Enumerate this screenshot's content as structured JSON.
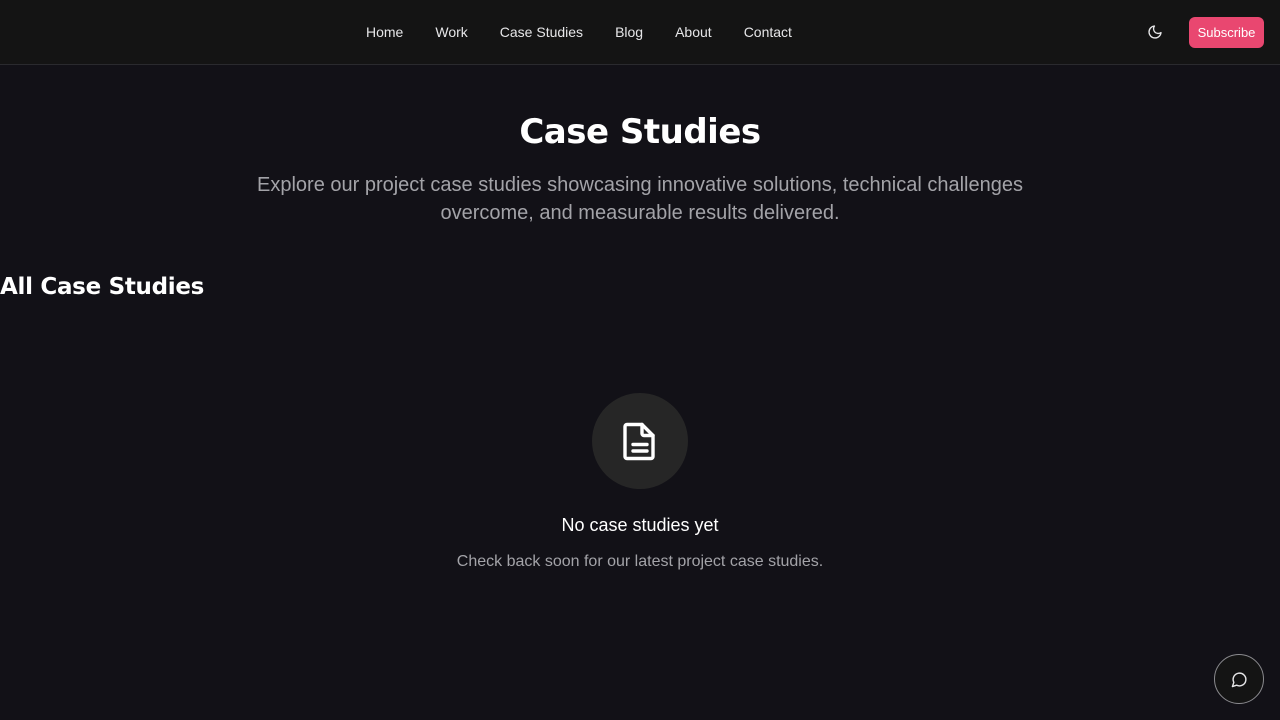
{
  "nav": {
    "items": [
      {
        "label": "Home"
      },
      {
        "label": "Work"
      },
      {
        "label": "Case Studies"
      },
      {
        "label": "Blog"
      },
      {
        "label": "About"
      },
      {
        "label": "Contact"
      }
    ],
    "theme_toggle_icon": "moon-icon",
    "subscribe_label": "Subscribe"
  },
  "hero": {
    "title": "Case Studies",
    "subtitle": "Explore our project case studies showcasing innovative solutions, technical challenges overcome, and measurable results delivered."
  },
  "section": {
    "title": "All Case Studies"
  },
  "empty_state": {
    "icon": "document-icon",
    "title": "No case studies yet",
    "description": "Check back soon for our latest project case studies."
  },
  "chat": {
    "icon": "chat-bubble-icon"
  },
  "colors": {
    "background": "#121117",
    "topbar": "#141414",
    "accent": "#e94770",
    "muted_text": "#a3a3a8",
    "icon_circle": "#262626"
  }
}
